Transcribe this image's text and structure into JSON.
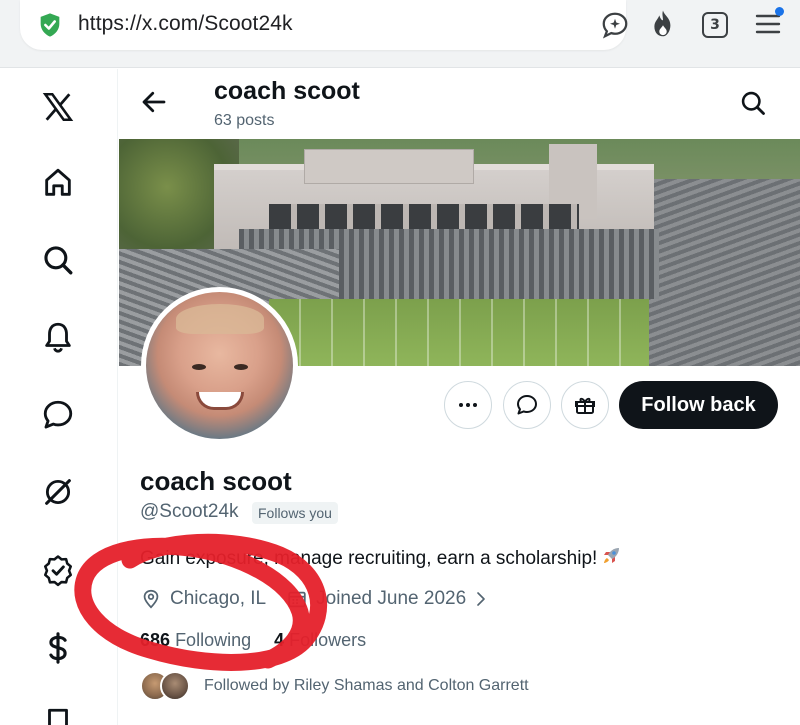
{
  "browser": {
    "url": "https://x.com/Scoot24k",
    "tab_count": "3",
    "icons": [
      "shield-check-icon",
      "sparkle-chat-icon",
      "fire-icon",
      "tabs-icon",
      "menu-icon"
    ]
  },
  "nav": {
    "items": [
      "x-logo-icon",
      "home-icon",
      "search-icon",
      "bell-icon",
      "chat-bubble-icon",
      "grok-icon",
      "verified-icon",
      "dollar-icon",
      "bookmark-icon"
    ]
  },
  "header": {
    "name": "coach scoot",
    "posts": "63 posts"
  },
  "actions": {
    "follow_label": "Follow back"
  },
  "profile": {
    "display_name": "coach scoot",
    "handle": "@Scoot24k",
    "follows_you": "Follows you",
    "bio_prefix": "Gain exposure, manage recruiting, earn a scholarship!",
    "location": "Chicago, IL",
    "joined": "Joined June 2026",
    "following_count": "686",
    "following_label": "Following",
    "followers_count": "4",
    "followers_label": "Followers",
    "followed_by": "Followed by Riley Shamas and Colton Garrett"
  },
  "colors": {
    "primary_text": "#0f1419",
    "secondary_text": "#536471",
    "annotation_red": "#e5202a"
  }
}
